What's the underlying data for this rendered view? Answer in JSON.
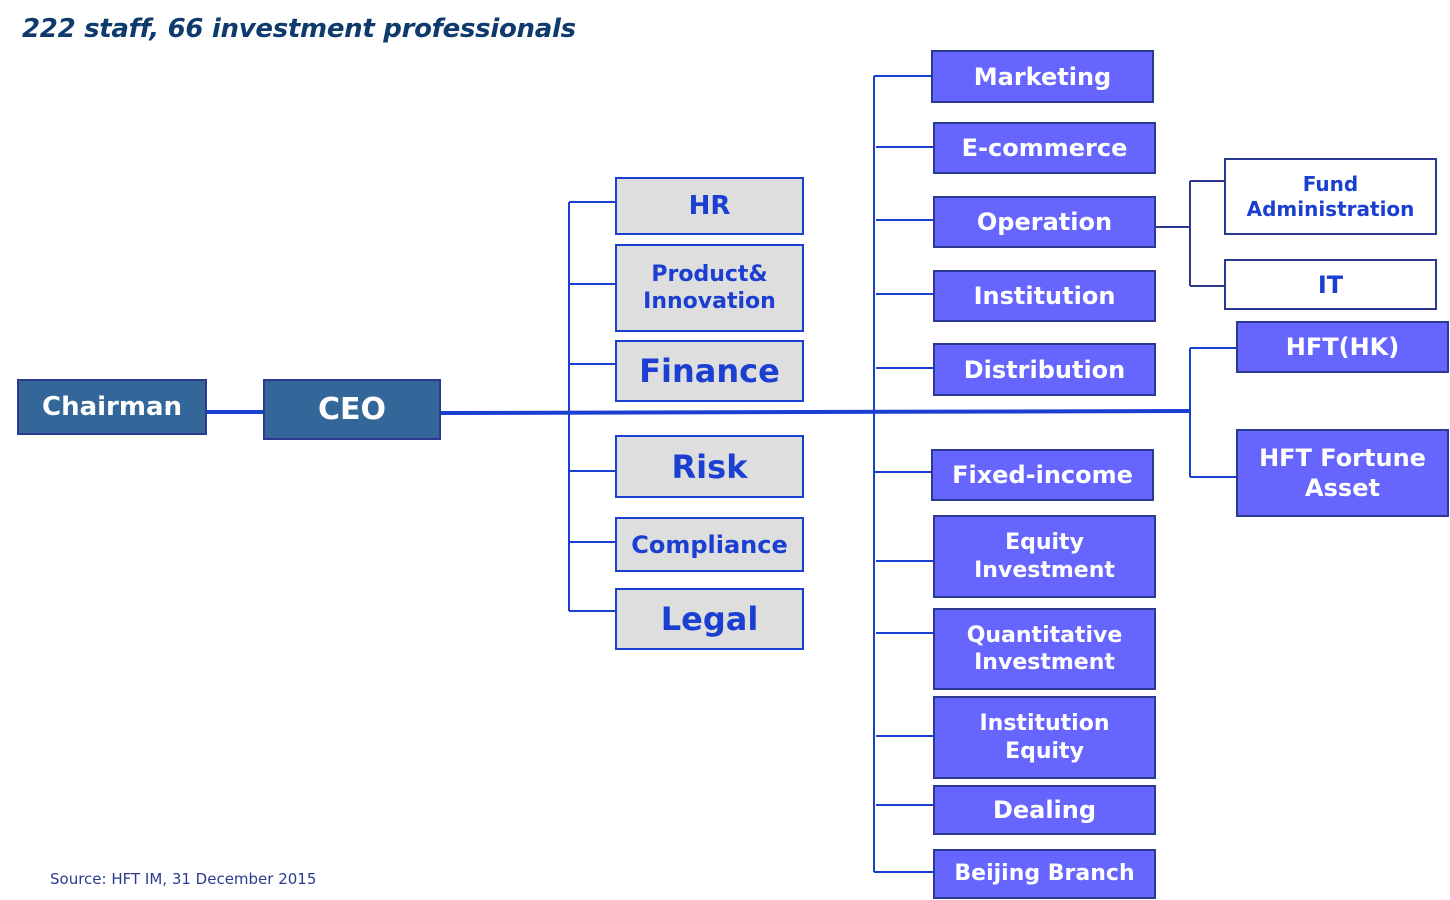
{
  "header": {
    "title": "222 staff, 66 investment professionals"
  },
  "footer": {
    "source": "Source: HFT IM, 31 December 2015"
  },
  "colors": {
    "executive_fill": "#336699",
    "support_fill": "#dedede",
    "support_text": "#1a3fd1",
    "business_fill": "#6666ff",
    "connector": "#1a3fd1",
    "title_text": "#0f3a6e"
  },
  "executive": {
    "chairman": "Chairman",
    "ceo": "CEO"
  },
  "support_functions": [
    "HR",
    "Product& Innovation",
    "Finance",
    "Risk",
    "Compliance",
    "Legal"
  ],
  "business_units": [
    "Marketing",
    "E-commerce",
    "Operation",
    "Institution",
    "Distribution",
    "Fixed-income",
    "Equity Investment",
    "Quantitative Investment",
    "Institution Equity",
    "Dealing",
    "Beijing Branch"
  ],
  "operation_subunits": [
    "Fund Administration",
    "IT"
  ],
  "subsidiaries": [
    "HFT(HK)",
    "HFT Fortune Asset"
  ]
}
